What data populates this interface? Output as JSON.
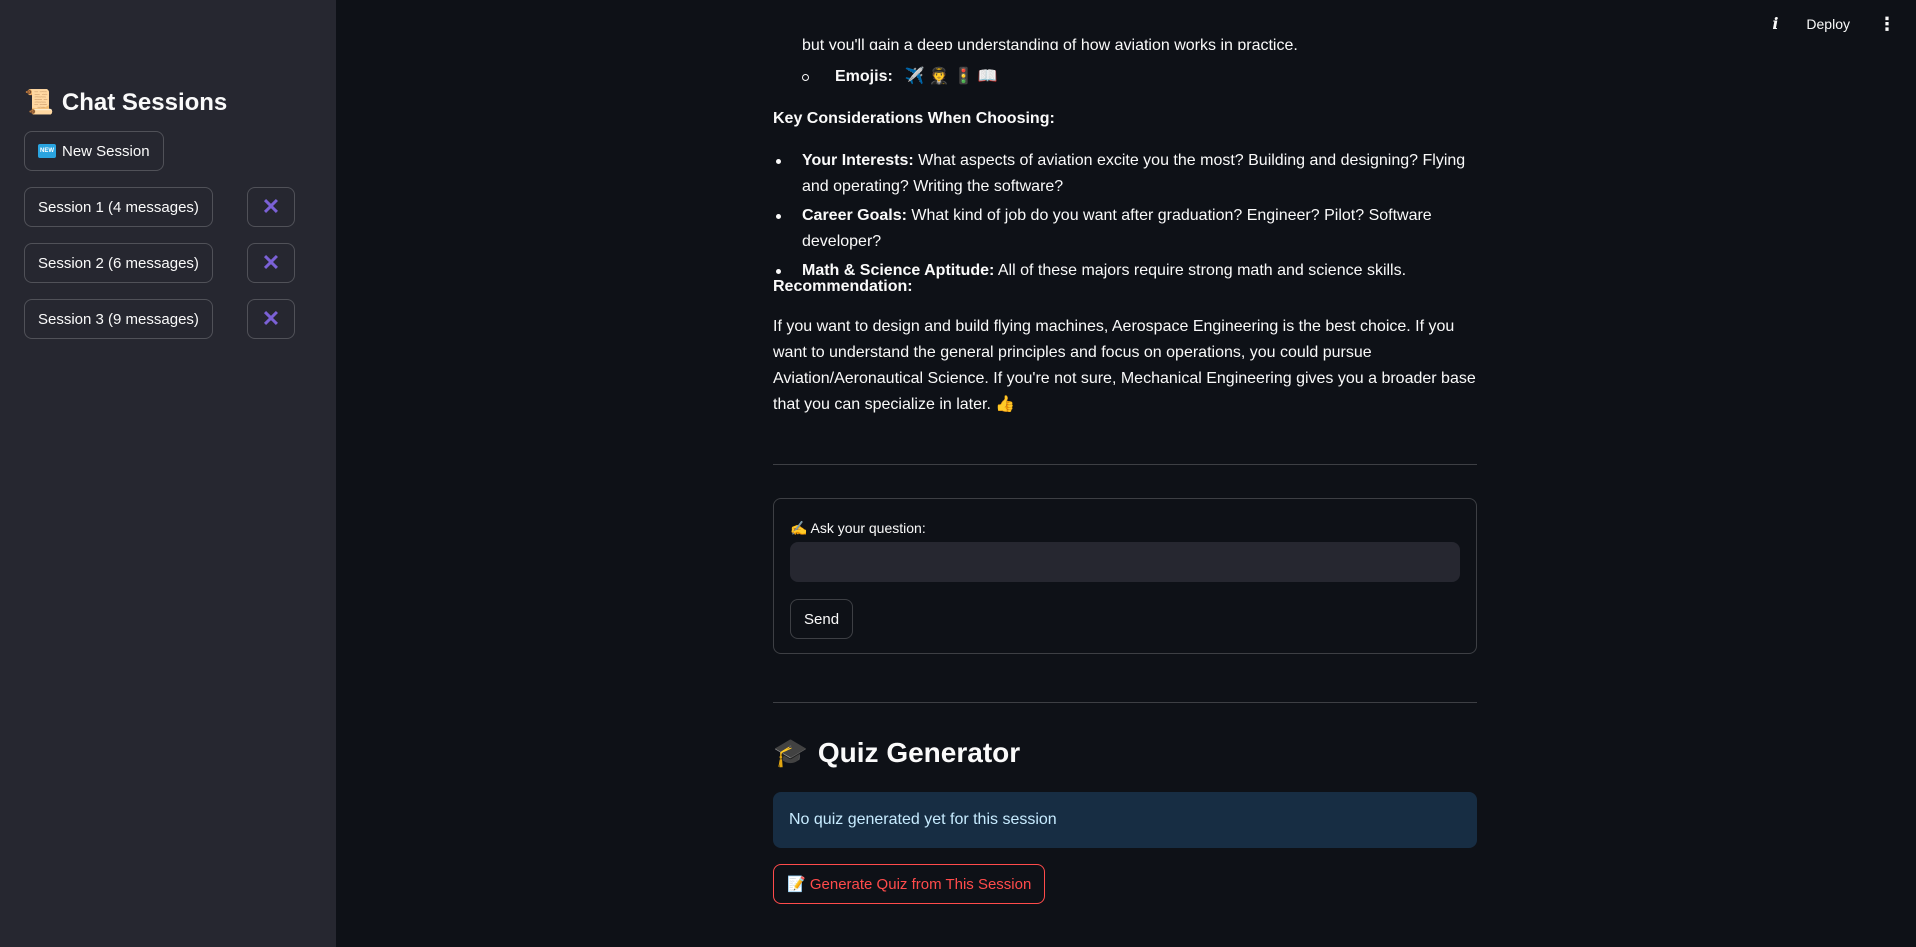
{
  "sidebar": {
    "title_icon": "📜",
    "title": "Chat Sessions",
    "new_session_icon": "NEW",
    "new_session_label": "New Session",
    "sessions": [
      {
        "label": "Session 1 (4 messages)"
      },
      {
        "label": "Session 2 (6 messages)"
      },
      {
        "label": "Session 3 (9 messages)"
      }
    ],
    "delete_glyph": "✕"
  },
  "topbar": {
    "info_glyph": "i",
    "deploy_label": "Deploy",
    "menu_glyph": "⋮"
  },
  "chat": {
    "cutoff_text": "but you'll gain a deep understanding of how aviation works in practice.",
    "emojis_label": "Emojis:",
    "emojis_value": "✈️ 🧑‍✈️ 🚦 📖",
    "key_heading": "Key Considerations When Choosing:",
    "considerations": [
      {
        "bold": "Your Interests:",
        "text": " What aspects of aviation excite you the most? Building and designing? Flying and operating? Writing the software?"
      },
      {
        "bold": "Career Goals:",
        "text": " What kind of job do you want after graduation? Engineer? Pilot? Software developer?"
      },
      {
        "bold": "Math & Science Aptitude:",
        "text": " All of these majors require strong math and science skills."
      }
    ],
    "rec_heading": "Recommendation:",
    "rec_body": "If you want to design and build flying machines, Aerospace Engineering is the best choice. If you want to understand the general principles and focus on operations, you could pursue Aviation/Aeronautical Science. If you're not sure, Mechanical Engineering gives you a broader base that you can specialize in later. 👍"
  },
  "form": {
    "label": "✍️ Ask your question:",
    "input_value": "",
    "send_label": "Send"
  },
  "quiz": {
    "title_icon": "🎓",
    "title": "Quiz Generator",
    "info": "No quiz generated yet for this session",
    "generate_label": "📝 Generate Quiz from This Session"
  },
  "colors": {
    "background": "#0e1117",
    "sidebar": "#262730",
    "accent_delete": "#7b61d6",
    "info_bg": "#172d43",
    "danger": "#ff4b4b"
  }
}
